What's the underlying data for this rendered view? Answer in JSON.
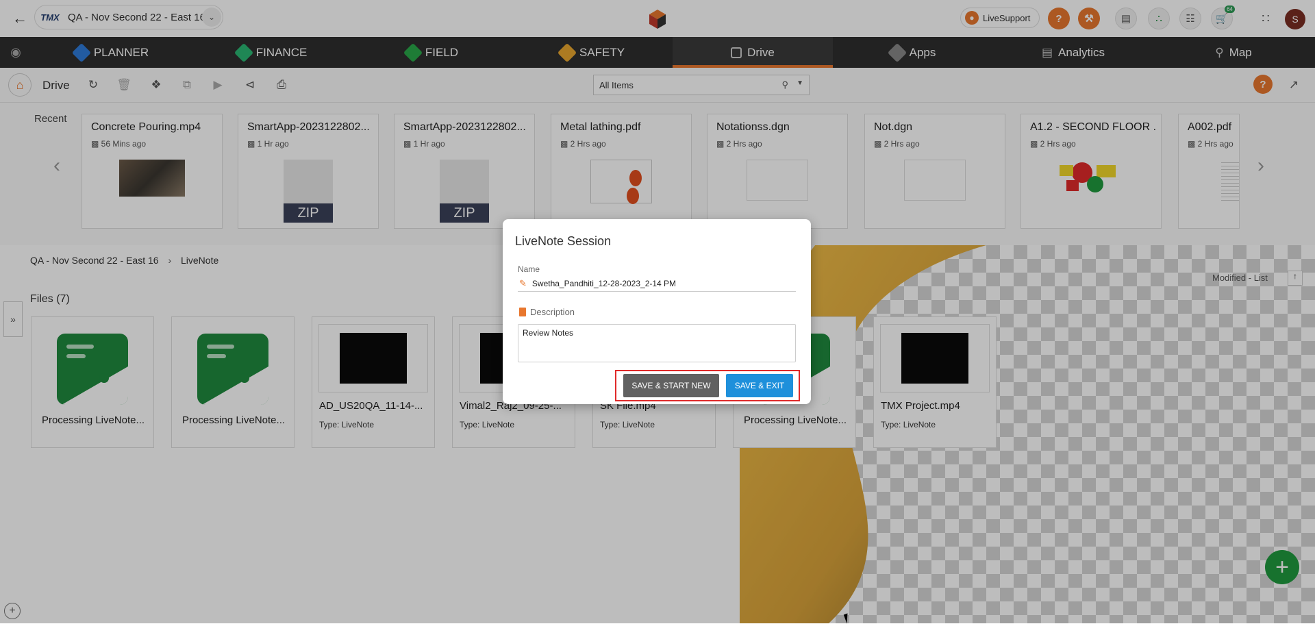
{
  "header": {
    "project_name": "QA - Nov Second 22 - East 16",
    "brand_logo": "TMX",
    "livesupport_label": "LiveSupport",
    "cart_badge": "64",
    "avatar_initial": "S"
  },
  "nav": {
    "items": [
      {
        "label": "PLANNER",
        "icon": "planner-icon"
      },
      {
        "label": "FINANCE",
        "icon": "finance-icon"
      },
      {
        "label": "FIELD",
        "icon": "field-icon"
      },
      {
        "label": "SAFETY",
        "icon": "safety-icon"
      },
      {
        "label": "Drive",
        "icon": "drive-icon",
        "active": true
      },
      {
        "label": "Apps",
        "icon": "apps-icon"
      },
      {
        "label": "Analytics",
        "icon": "analytics-icon"
      },
      {
        "label": "Map",
        "icon": "map-icon"
      }
    ]
  },
  "toolbar": {
    "title": "Drive",
    "filter_value": "All Items"
  },
  "recent": {
    "label": "Recent",
    "items": [
      {
        "name": "Concrete Pouring.mp4",
        "time": "56 Mins ago",
        "thumb": "photo"
      },
      {
        "name": "SmartApp-2023122802...",
        "time": "1 Hr ago",
        "thumb": "zip"
      },
      {
        "name": "SmartApp-2023122802...",
        "time": "1 Hr ago",
        "thumb": "zip"
      },
      {
        "name": "Metal lathing.pdf",
        "time": "2 Hrs ago",
        "thumb": "drawing"
      },
      {
        "name": "Notationss.dgn",
        "time": "2 Hrs ago",
        "thumb": "blank"
      },
      {
        "name": "Not.dgn",
        "time": "2 Hrs ago",
        "thumb": "blank"
      },
      {
        "name": "A1.2 - SECOND FLOOR ...",
        "time": "2 Hrs ago",
        "thumb": "shapes"
      },
      {
        "name": "A002.pdf",
        "time": "2 Hrs ago",
        "thumb": "sheet"
      }
    ],
    "zip_label": "ZIP"
  },
  "breadcrumb": {
    "root": "QA - Nov Second 22 - East 16",
    "current": "LiveNote"
  },
  "files": {
    "label": "Files (7)",
    "sort_label": "Modified - List",
    "type_prefix": "Type:",
    "items": [
      {
        "name": "Processing LiveNote...",
        "kind": "livenote"
      },
      {
        "name": "Processing LiveNote...",
        "kind": "livenote"
      },
      {
        "name": "AD_US20QA_11-14-...",
        "kind": "video",
        "type": "LiveNote"
      },
      {
        "name": "Vimal2_Raj2_09-25-...",
        "kind": "video",
        "type": "LiveNote"
      },
      {
        "name": "SK File.mp4",
        "kind": "video",
        "type": "LiveNote"
      },
      {
        "name": "Processing LiveNote...",
        "kind": "livenote"
      },
      {
        "name": "TMX Project.mp4",
        "kind": "video",
        "type": "LiveNote"
      }
    ]
  },
  "modal": {
    "title": "LiveNote Session",
    "name_label": "Name",
    "name_value": "Swetha_Pandhiti_12-28-2023_2-14 PM",
    "description_label": "Description",
    "description_value": "Review Notes",
    "save_new_label": "SAVE & START NEW",
    "save_exit_label": "SAVE & EXIT"
  },
  "colors": {
    "accent": "#e8772e",
    "nav_bg": "#2f2f2f",
    "primary_button": "#1e90db",
    "secondary_button": "#616161",
    "highlight": "#e02a2a",
    "fab": "#1f9a3f"
  }
}
